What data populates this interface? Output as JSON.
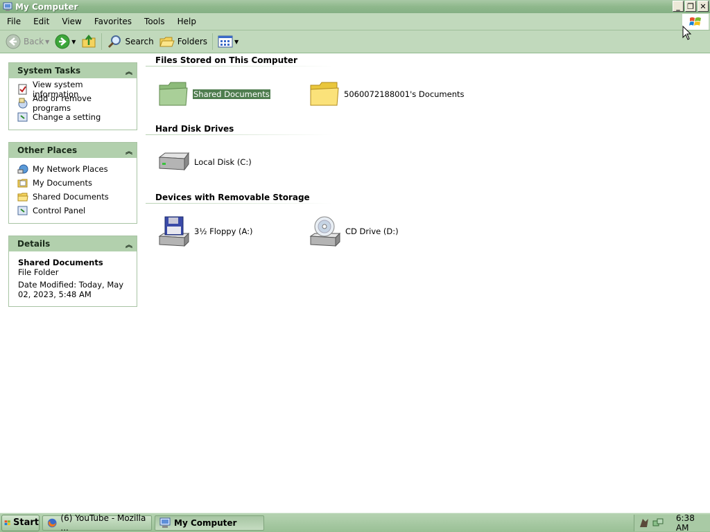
{
  "window": {
    "title": "My Computer"
  },
  "titlebar_buttons": {
    "minimize": "_",
    "restore": "❐",
    "close": "✕"
  },
  "menu": [
    "File",
    "Edit",
    "View",
    "Favorites",
    "Tools",
    "Help"
  ],
  "toolbar": {
    "back": "Back",
    "search": "Search",
    "folders": "Folders"
  },
  "left": {
    "system_tasks": {
      "title": "System Tasks",
      "items": [
        "View system information",
        "Add or remove programs",
        "Change a setting"
      ]
    },
    "other_places": {
      "title": "Other Places",
      "items": [
        "My Network Places",
        "My Documents",
        "Shared Documents",
        "Control Panel"
      ]
    },
    "details": {
      "title": "Details",
      "name": "Shared Documents",
      "type": "File Folder",
      "modified": "Date Modified: Today, May 02, 2023, 5:48 AM"
    }
  },
  "groups": {
    "files": {
      "title": "Files Stored on This Computer",
      "items": [
        "Shared Documents",
        "5060072188001's Documents"
      ]
    },
    "hdd": {
      "title": "Hard Disk Drives",
      "items": [
        "Local Disk (C:)"
      ]
    },
    "removable": {
      "title": "Devices with Removable Storage",
      "items": [
        "3½ Floppy (A:)",
        "CD Drive (D:)"
      ]
    }
  },
  "taskbar": {
    "start": "Start",
    "tasks": [
      "(6) YouTube - Mozilla ...",
      "My Computer"
    ],
    "clock": "6:38 AM"
  },
  "colors": {
    "accent": "#84b084",
    "selection": "#4f7d4f",
    "panel_header": "#b2d0ad"
  }
}
